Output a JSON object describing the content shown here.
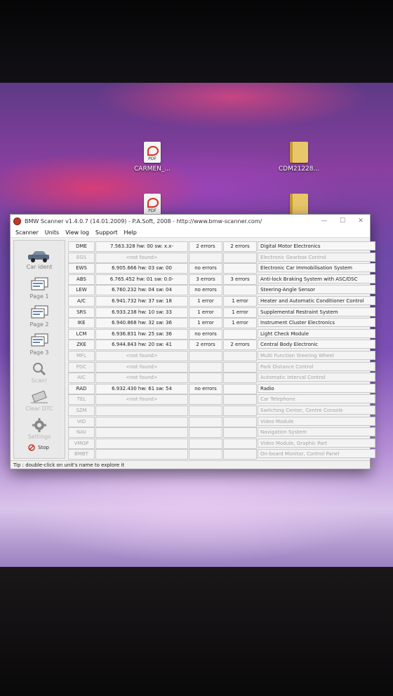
{
  "desktop": {
    "icons": [
      {
        "name": "CARMEN_...",
        "type": "pdf"
      },
      {
        "name": "CDM21228...",
        "type": "folder"
      },
      {
        "name": "",
        "type": "pdf"
      },
      {
        "name": "",
        "type": "folder"
      }
    ],
    "pdf_badge": "PDF"
  },
  "window": {
    "title": "BMW Scanner v1.4.0.7 (14.01.2009) - P.A.Soft, 2008 - http://www.bmw-scanner.com/",
    "controls": {
      "minimize": "—",
      "maximize": "☐",
      "close": "✕"
    },
    "menu": [
      "Scanner",
      "Units",
      "View log",
      "Support",
      "Help"
    ]
  },
  "sidebar": {
    "buttons": [
      {
        "label": "Car ident",
        "icon": "car-icon",
        "enabled": true
      },
      {
        "label": "Page 1",
        "icon": "page-icon",
        "enabled": true
      },
      {
        "label": "Page 2",
        "icon": "page-icon",
        "enabled": true
      },
      {
        "label": "Page 3",
        "icon": "page-icon",
        "enabled": true
      },
      {
        "label": "Scan!",
        "icon": "scan-icon",
        "enabled": false
      },
      {
        "label": "Clear DTC",
        "icon": "eraser-icon",
        "enabled": false
      },
      {
        "label": "Settings",
        "icon": "gear-icon",
        "enabled": false
      }
    ],
    "stop_label": "Stop"
  },
  "units": [
    {
      "code": "DME",
      "info": "7.563.328   hw: 00   sw: x.x-",
      "err1": "2 errors",
      "err2": "2 errors",
      "name": "Digital Motor Electronics",
      "present": true
    },
    {
      "code": "EGS",
      "info": "<not found>",
      "err1": "",
      "err2": "",
      "name": "Electronic Gearbox Control",
      "present": false
    },
    {
      "code": "EWS",
      "info": "6.905.666   hw: 03   sw: 00",
      "err1": "no errors",
      "err2": "",
      "name": "Electronic Car Immobilisation System",
      "present": true
    },
    {
      "code": "ABS",
      "info": "6.765.452   hw: 01   sw: 0.0-",
      "err1": "3 errors",
      "err2": "3 errors",
      "name": "Anti-lock Braking System with ASC/DSC",
      "present": true
    },
    {
      "code": "LEW",
      "info": "6.760.232   hw: 04   sw: 04",
      "err1": "no errors",
      "err2": "",
      "name": "Steering-Angle Sensor",
      "present": true
    },
    {
      "code": "A/C",
      "info": "6.941.732   hw: 37   sw: 18",
      "err1": "1 error",
      "err2": "1 error",
      "name": "Heater and Automatic Conditioner Control",
      "present": true
    },
    {
      "code": "SRS",
      "info": "6.933.238   hw: 10   sw: 33",
      "err1": "1 error",
      "err2": "1 error",
      "name": "Supplemental Restraint System",
      "present": true
    },
    {
      "code": "IKE",
      "info": "6.940.868   hw: 32   sw: 36",
      "err1": "1 error",
      "err2": "1 error",
      "name": "Instrument Cluster Electronics",
      "present": true
    },
    {
      "code": "LCM",
      "info": "6.936.831   hw: 25   sw: 36",
      "err1": "no errors",
      "err2": "",
      "name": "Light Check Module",
      "present": true
    },
    {
      "code": "ZKE",
      "info": "6.944.843   hw: 20   sw: 41",
      "err1": "2 errors",
      "err2": "2 errors",
      "name": "Central Body Electronic",
      "present": true
    },
    {
      "code": "MFL",
      "info": "<not found>",
      "err1": "",
      "err2": "",
      "name": "Multi Function Steering Wheel",
      "present": false
    },
    {
      "code": "PDC",
      "info": "<not found>",
      "err1": "",
      "err2": "",
      "name": "Park Distance Control",
      "present": false
    },
    {
      "code": "AIC",
      "info": "<not found>",
      "err1": "",
      "err2": "",
      "name": "Automatic Interval Control",
      "present": false
    },
    {
      "code": "RAD",
      "info": "6.932.430   hw: 61   sw: 54",
      "err1": "no errors",
      "err2": "",
      "name": "Radio",
      "present": true
    },
    {
      "code": "TEL",
      "info": "<not found>",
      "err1": "",
      "err2": "",
      "name": "Car Telephone",
      "present": false
    },
    {
      "code": "SZM",
      "info": "",
      "err1": "",
      "err2": "",
      "name": "Switching Center, Centre Console",
      "present": false
    },
    {
      "code": "VID",
      "info": "",
      "err1": "",
      "err2": "",
      "name": "Video Module",
      "present": false
    },
    {
      "code": "NAV",
      "info": "",
      "err1": "",
      "err2": "",
      "name": "Navigation System",
      "present": false
    },
    {
      "code": "VMGP",
      "info": "",
      "err1": "",
      "err2": "",
      "name": "Video Module, Graphic Part",
      "present": false
    },
    {
      "code": "BMBT",
      "info": "",
      "err1": "",
      "err2": "",
      "name": "On-board Monitor, Control Panel",
      "present": false
    }
  ],
  "status": {
    "tip": "Tip : double-click on unit's name to explore it"
  }
}
